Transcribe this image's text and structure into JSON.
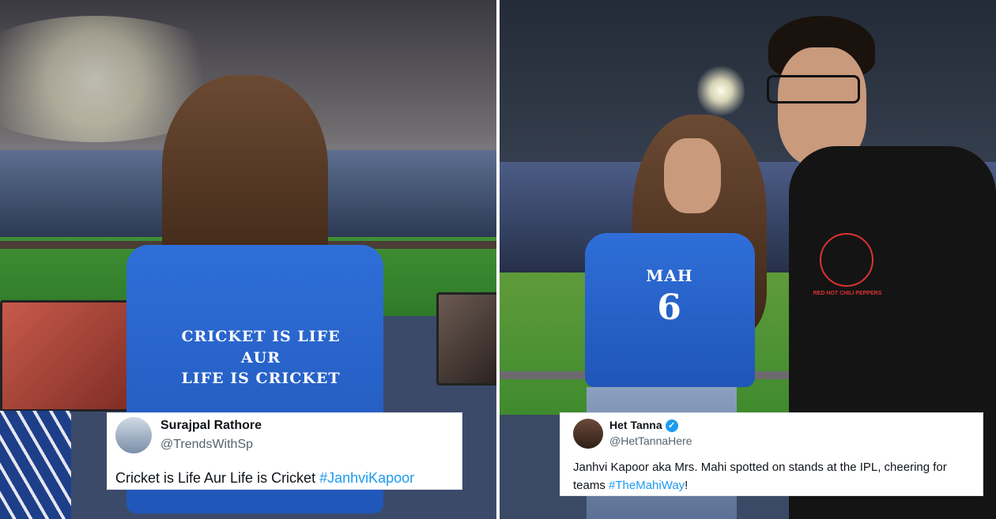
{
  "left": {
    "shirt_lines": [
      "CRICKET IS LIFE",
      "AUR",
      "LIFE IS CRICKET"
    ],
    "tweet": {
      "name": "Surajpal Rathore",
      "handle": "@TrendsWithSp",
      "text_prefix": "Cricket is Life Aur Life is Cricket ",
      "hashtag": "#JanhviKapoor"
    }
  },
  "right": {
    "shirt_name": "MAH",
    "shirt_number": "6",
    "tee_print": "RED HOT CHILI PEPPERS",
    "tweet": {
      "name": "Het Tanna",
      "handle": "@HetTannaHere",
      "text_line1": "Janhvi Kapoor aka Mrs. Mahi spotted on stands at the IPL, cheering for",
      "text_prefix2": "teams ",
      "hashtag": "#TheMahiWay",
      "text_suffix2": "!"
    }
  },
  "colors": {
    "jersey_blue": "#2f6ed8",
    "link_blue": "#1d9bf0"
  }
}
